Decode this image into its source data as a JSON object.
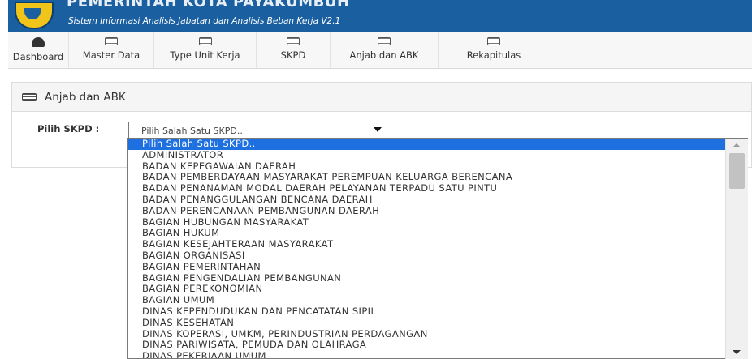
{
  "header": {
    "title": "PEMERINTAH KOTA PAYAKUMBUH",
    "subtitle": "Sistem Informasi Analisis Jabatan dan Analisis Beban Kerja V2.1"
  },
  "nav": {
    "items": [
      {
        "label": "Dashboard",
        "icon": "dashboard-icon"
      },
      {
        "label": "Master Data",
        "icon": "list-icon"
      },
      {
        "label": "Type Unit Kerja",
        "icon": "list-icon"
      },
      {
        "label": "SKPD",
        "icon": "list-icon"
      },
      {
        "label": "Anjab dan ABK",
        "icon": "list-icon"
      },
      {
        "label": "Rekapitulas",
        "icon": "list-icon"
      }
    ]
  },
  "panel": {
    "title": "Anjab dan ABK",
    "pilih_label": "Pilih SKPD :",
    "select_value": "Pilih Salah Satu SKPD.."
  },
  "dropdown": {
    "options": [
      "Pilih Salah Satu SKPD..",
      "ADMINISTRATOR",
      "BADAN KEPEGAWAIAN DAERAH",
      "BADAN PEMBERDAYAAN MASYARAKAT PEREMPUAN KELUARGA BERENCANA",
      "BADAN PENANAMAN MODAL DAERAH PELAYANAN TERPADU SATU PINTU",
      "BADAN PENANGGULANGAN BENCANA DAERAH",
      "BADAN PERENCANAAN PEMBANGUNAN DAERAH",
      "BAGIAN HUBUNGAN MASYARAKAT",
      "BAGIAN HUKUM",
      "BAGIAN KESEJAHTERAAN MASYARAKAT",
      "BAGIAN ORGANISASI",
      "BAGIAN PEMERINTAHAN",
      "BAGIAN PENGENDALIAN PEMBANGUNAN",
      "BAGIAN PEREKONOMIAN",
      "BAGIAN UMUM",
      "DINAS KEPENDUDUKAN DAN PENCATATAN SIPIL",
      "DINAS KESEHATAN",
      "DINAS KOPERASI, UMKM, PERINDUSTRIAN PERDAGANGAN",
      "DINAS PARIWISATA, PEMUDA DAN OLAHRAGA",
      "DINAS PEKERJAAN UMUM"
    ]
  },
  "colors": {
    "header_bg": "#1a5fa0",
    "selected_option_bg": "#1e6fe0"
  }
}
